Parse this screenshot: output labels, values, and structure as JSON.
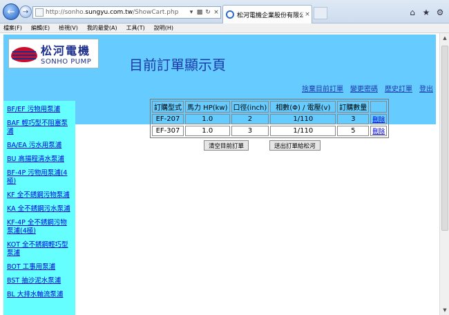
{
  "browser": {
    "url_prefix": "http://sonho.",
    "url_domain": "sungyu.com.tw",
    "url_path": "/ShowCart.php",
    "tab_title": "松河電機企業股份有限公司...",
    "tab_close": "×",
    "new_tab": "",
    "icons": [
      "home-icon",
      "star-icon",
      "gear-icon"
    ]
  },
  "menu": {
    "items": [
      "檔案(F)",
      "編輯(E)",
      "檢視(V)",
      "我的最愛(A)",
      "工具(T)",
      "說明(H)"
    ]
  },
  "header": {
    "logo_cn": "松河電機",
    "logo_en": "SONHO PUMP",
    "title": "目前訂單顯示頁",
    "links": [
      "捨棄目前訂單",
      "變更密碼",
      "歷史訂單",
      "登出"
    ],
    "bg_color": "#66ccff"
  },
  "sidebar": {
    "bg_color": "#66ffff",
    "items": [
      "BF/EF 污物用泵浦",
      "BAF 輕巧型不阻塞泵浦",
      "BA/EA 污水用泵浦",
      "BU 高揚程清水泵浦",
      "BF-4P 污物用泵浦(4極)",
      "KF 全不銹鋼污物泵浦",
      "KA 全不銹鋼污水泵浦",
      "KF-4P 全不銹鋼污物泵浦(4極)",
      "KOT 全不銹鋼輕巧型泵浦",
      "BOT 工事用泵浦",
      "BST 抽沙泥水泵浦",
      "BL 大排水軸流泵浦"
    ]
  },
  "order": {
    "headers": [
      "訂購型式",
      "馬力 HP(kw)",
      "口徑(inch)",
      "相數(Φ) / 電壓(v)",
      "訂購數量",
      ""
    ],
    "rows": [
      {
        "model": "EF-207",
        "hp": "1.0",
        "bore": "2",
        "phase_volt": "1/110",
        "qty": "3",
        "action": "刪除"
      },
      {
        "model": "EF-307",
        "hp": "1.0",
        "bore": "3",
        "phase_volt": "1/110",
        "qty": "5",
        "action": "刪除"
      }
    ],
    "clear_button": "清空目前訂單",
    "submit_button": "送出訂單給松河"
  }
}
